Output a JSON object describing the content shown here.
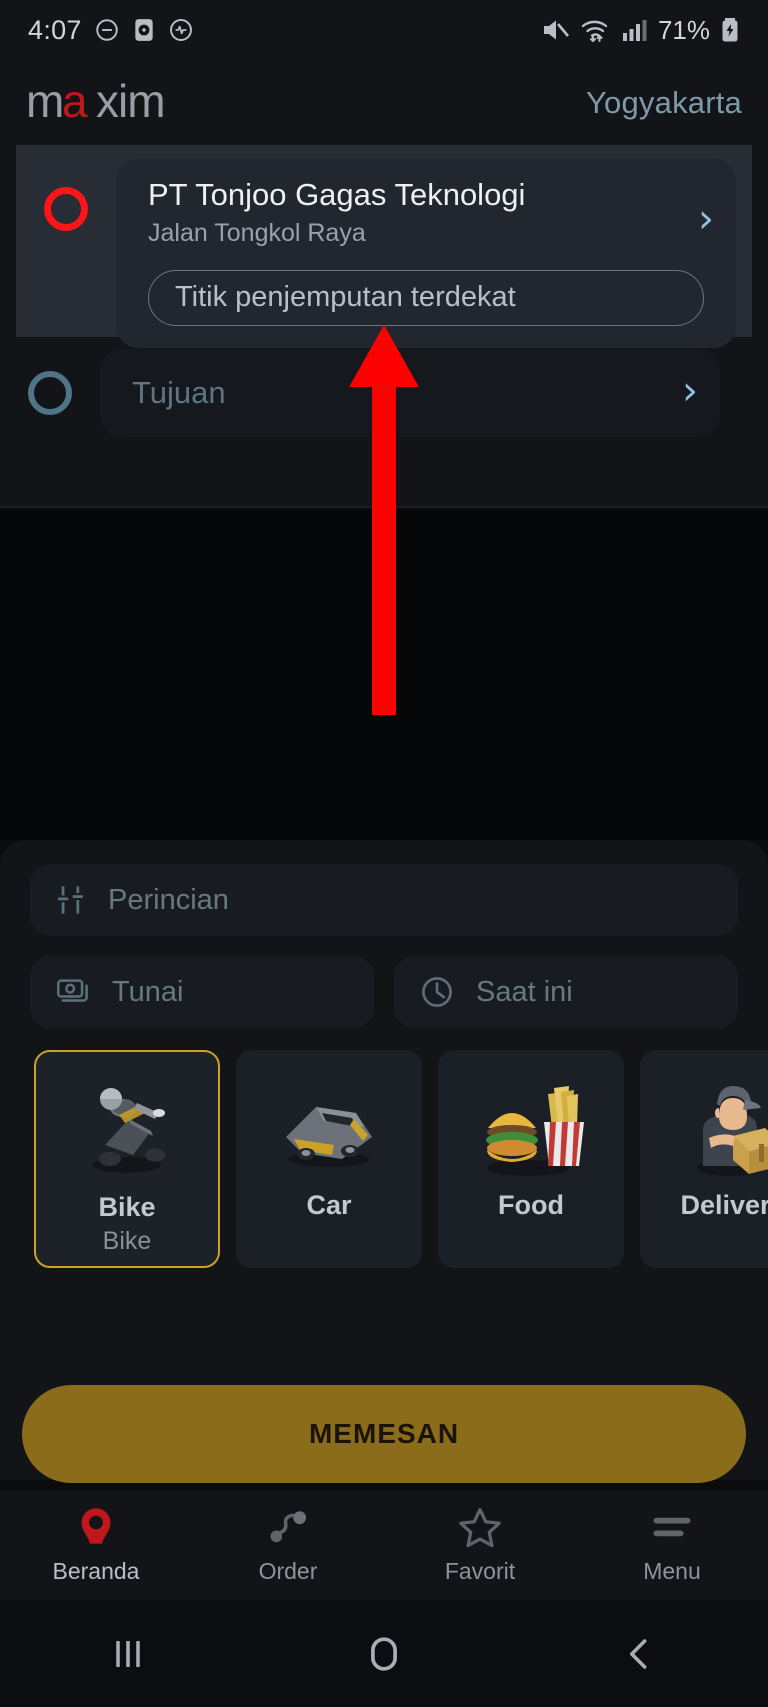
{
  "status_bar": {
    "time": "4:07",
    "battery_percent": "71%",
    "icons": [
      "dnd-icon",
      "alarm-icon",
      "heart-monitor-icon",
      "mute-icon",
      "wifi-icon",
      "signal-icon",
      "battery-charging-icon"
    ]
  },
  "header": {
    "logo_text": "maxim",
    "city": "Yogyakarta",
    "accent_red": "#d01c1f",
    "city_color": "#7d9aa8"
  },
  "route": {
    "origin": {
      "title": "PT Tonjoo Gagas Teknologi",
      "subtitle": "Jalan Tongkol Raya",
      "pickup_pill": "Titik penjemputan terdekat",
      "marker_color": "#ff1418",
      "chevron": "›"
    },
    "destination": {
      "placeholder": "Tujuan",
      "marker_color": "#4d7585",
      "chevron": "›"
    }
  },
  "options": {
    "details": {
      "label": "Perincian",
      "icon": "tune-sliders-icon"
    },
    "payment": {
      "label": "Tunai",
      "icon": "cash-icon"
    },
    "time": {
      "label": "Saat ini",
      "icon": "clock-icon"
    }
  },
  "services": [
    {
      "label": "Bike",
      "sublabel": "Bike",
      "icon": "scooter-icon",
      "selected": true
    },
    {
      "label": "Car",
      "sublabel": "",
      "icon": "car-icon",
      "selected": false
    },
    {
      "label": "Food",
      "sublabel": "",
      "icon": "burger-fries-icon",
      "selected": false
    },
    {
      "label": "Delivery",
      "sublabel": "",
      "icon": "courier-icon",
      "selected": false
    }
  ],
  "order_button": {
    "label": "MEMESAN",
    "color": "#8a6c1a"
  },
  "bottom_nav": [
    {
      "label": "Beranda",
      "icon": "maxim-pin-icon",
      "active": true
    },
    {
      "label": "Order",
      "icon": "route-icon",
      "active": false
    },
    {
      "label": "Favorit",
      "icon": "star-icon",
      "active": false
    },
    {
      "label": "Menu",
      "icon": "hamburger-icon",
      "active": false
    }
  ],
  "android_nav": {
    "recents": "recents-icon",
    "home": "home-icon",
    "back": "back-icon"
  },
  "annotation": {
    "arrow_color": "#fd0000",
    "points_to": "Titik penjemputan terdekat"
  }
}
